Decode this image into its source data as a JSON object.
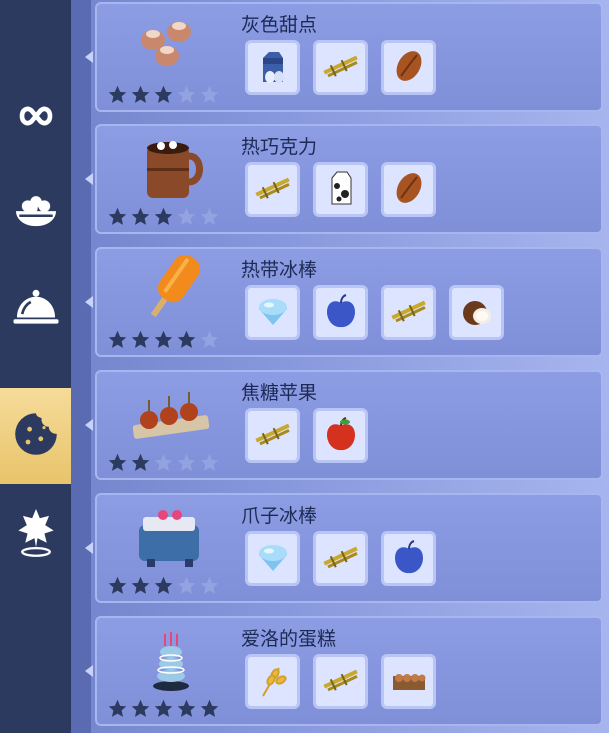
{
  "sidebar": {
    "items": [
      {
        "icon": "infinity-icon",
        "active": false
      },
      {
        "icon": "salad-bowl-icon",
        "active": false
      },
      {
        "icon": "serving-cloche-icon",
        "active": false
      },
      {
        "icon": "cookie-icon",
        "active": true
      },
      {
        "icon": "star-location-icon",
        "active": false
      }
    ]
  },
  "recipes": [
    {
      "name": "灰色甜点",
      "dish_icon": "gray-dessert-dish",
      "stars": 3,
      "max_stars": 5,
      "ingredients": [
        "milk-carton-eggs-icon",
        "sugarcane-icon",
        "cocoa-bean-icon"
      ]
    },
    {
      "name": "热巧克力",
      "dish_icon": "hot-chocolate-mug",
      "stars": 3,
      "max_stars": 5,
      "ingredients": [
        "sugarcane-icon",
        "milk-carton-icon",
        "cocoa-bean-icon"
      ]
    },
    {
      "name": "热带冰棒",
      "dish_icon": "orange-popsicle",
      "stars": 4,
      "max_stars": 5,
      "ingredients": [
        "ice-icon",
        "blue-apple-icon",
        "sugarcane-icon",
        "coconut-icon"
      ]
    },
    {
      "name": "焦糖苹果",
      "dish_icon": "caramel-apples",
      "stars": 2,
      "max_stars": 5,
      "ingredients": [
        "sugarcane-icon",
        "red-apple-icon"
      ]
    },
    {
      "name": "爪子冰棒",
      "dish_icon": "paw-popsicle-cooler",
      "stars": 3,
      "max_stars": 5,
      "ingredients": [
        "ice-icon",
        "sugarcane-icon",
        "blue-apple-icon"
      ]
    },
    {
      "name": "爱洛的蛋糕",
      "dish_icon": "layered-cake",
      "stars": 5,
      "max_stars": 5,
      "ingredients": [
        "wheat-icon",
        "sugarcane-icon",
        "egg-crate-icon"
      ]
    }
  ],
  "colors": {
    "sidebar_bg": "#2b3a5e",
    "active_tab": "#f0d07e",
    "card_bg": "#8797dc",
    "star_filled": "#2b3a5e",
    "star_empty": "#93a2e0"
  }
}
